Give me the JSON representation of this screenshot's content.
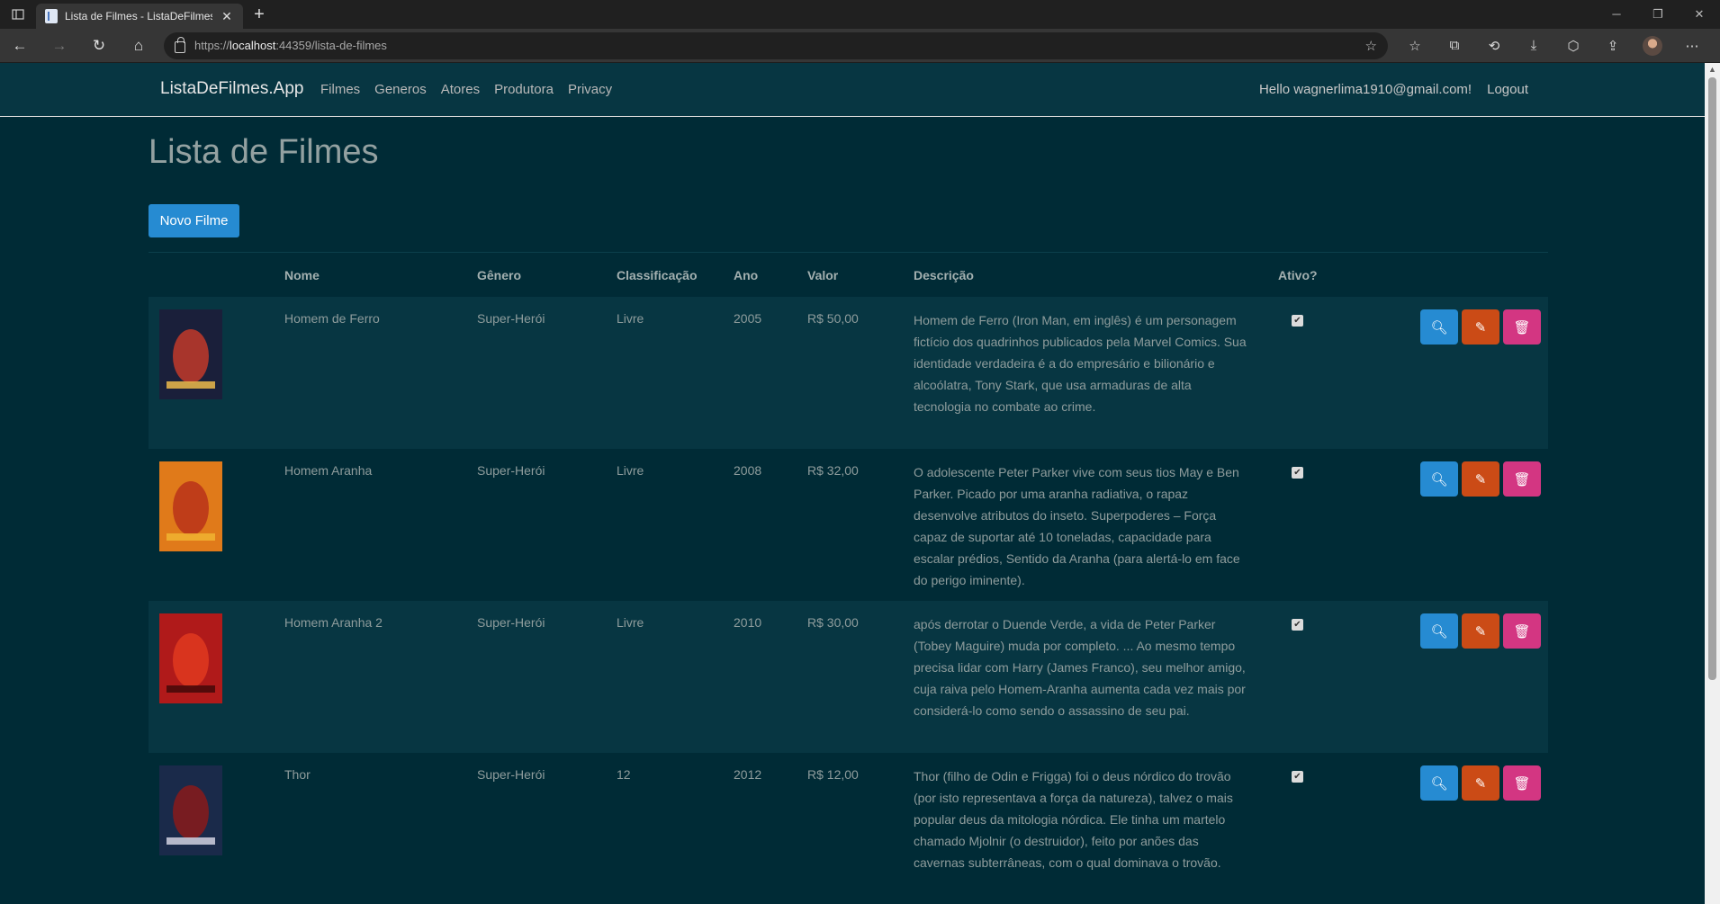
{
  "browser": {
    "tab_title": "Lista de Filmes - ListaDeFilmes.A",
    "url_scheme": "https://",
    "url_host": "localhost",
    "url_rest": ":44359/lista-de-filmes"
  },
  "navbar": {
    "brand": "ListaDeFilmes.App",
    "links": [
      "Filmes",
      "Generos",
      "Atores",
      "Produtora",
      "Privacy"
    ],
    "greeting": "Hello wagnerlima1910@gmail.com!",
    "logout": "Logout"
  },
  "page": {
    "title": "Lista de Filmes",
    "new_button": "Novo Filme"
  },
  "table": {
    "headers": [
      "Nome",
      "Gênero",
      "Classificação",
      "Ano",
      "Valor",
      "Descrição",
      "Ativo?"
    ],
    "rows": [
      {
        "nome": "Homem de Ferro",
        "genero": "Super-Herói",
        "classificacao": "Livre",
        "ano": "2005",
        "valor": "R$ 50,00",
        "descricao": "Homem de Ferro (Iron Man, em inglês) é um personagem fictício dos quadrinhos publicados pela Marvel Comics. Sua identidade verdadeira é a do empresário e bilionário e alcoólatra, Tony Stark, que usa armaduras de alta tecnologia no combate ao crime.",
        "ativo": true,
        "poster_colors": [
          "#1a1f3a",
          "#c23a2a",
          "#e0b04a"
        ]
      },
      {
        "nome": "Homem Aranha",
        "genero": "Super-Herói",
        "classificacao": "Livre",
        "ano": "2008",
        "valor": "R$ 32,00",
        "descricao": "O adolescente Peter Parker vive com seus tios May e Ben Parker. Picado por uma aranha radiativa, o rapaz desenvolve atributos do inseto. Superpoderes – Força capaz de suportar até 10 toneladas, capacidade para escalar prédios, Sentido da Aranha (para alertá-lo em face do perigo iminente).",
        "ativo": true,
        "poster_colors": [
          "#e07a1a",
          "#b8321a",
          "#f0b030"
        ]
      },
      {
        "nome": "Homem Aranha 2",
        "genero": "Super-Herói",
        "classificacao": "Livre",
        "ano": "2010",
        "valor": "R$ 30,00",
        "descricao": "após derrotar o Duende Verde, a vida de Peter Parker (Tobey Maguire) muda por completo. ... Ao mesmo tempo precisa lidar com Harry (James Franco), seu melhor amigo, cuja raiva pelo Homem-Aranha aumenta cada vez mais por considerá-lo como sendo o assassino de seu pai.",
        "ativo": true,
        "poster_colors": [
          "#b01a1a",
          "#e03a20",
          "#4a0a0a"
        ]
      },
      {
        "nome": "Thor",
        "genero": "Super-Herói",
        "classificacao": "12",
        "ano": "2012",
        "valor": "R$ 12,00",
        "descricao": "Thor (filho de Odin e Frigga) foi o deus nórdico do trovão (por isto representava a força da natureza), talvez o mais popular deus da mitologia nórdica. Ele tinha um martelo chamado Mjolnir (o destruidor), feito por anões das cavernas subterrâneas, com o qual dominava o trovão.",
        "ativo": true,
        "poster_colors": [
          "#1a2a4a",
          "#8a1a1a",
          "#c8c8d8"
        ]
      }
    ]
  },
  "icons": {
    "view": "search-icon",
    "edit": "pencil-icon",
    "delete": "trash-icon"
  }
}
